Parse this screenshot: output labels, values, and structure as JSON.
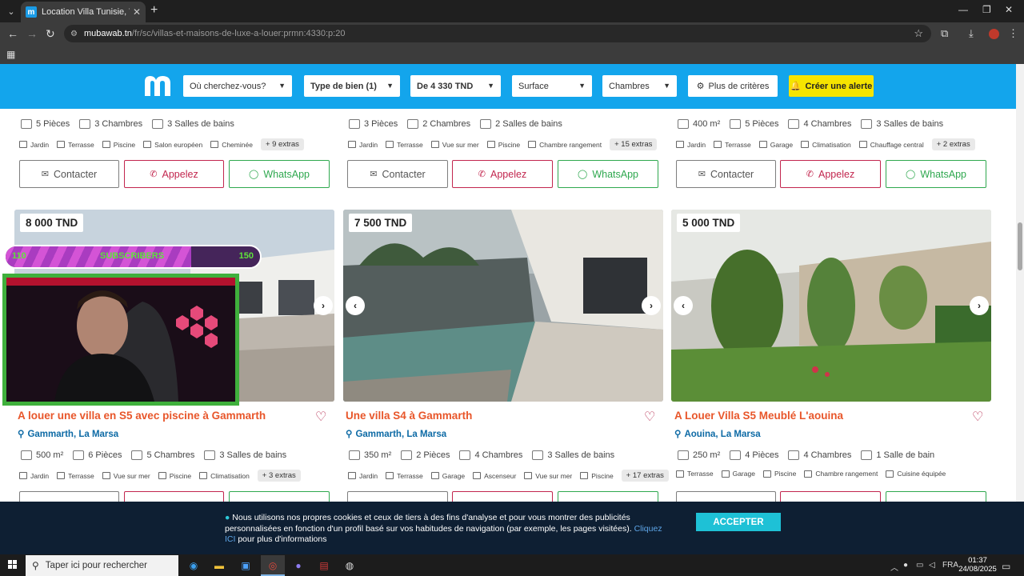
{
  "browser": {
    "tab_title": "Location Villa Tunisie, Villa à Lo",
    "favicon_letter": "m",
    "url_host": "mubawab.tn",
    "url_path": "/fr/sc/villas-et-maisons-de-luxe-a-louer:prmn:4330:p:20"
  },
  "header": {
    "where": "Où cherchez-vous?",
    "type": "Type de bien (1)",
    "price": "De 4 330 TND",
    "surface": "Surface",
    "rooms": "Chambres",
    "more": "Plus de critères",
    "alert": "Créer une alerte"
  },
  "top_row": [
    {
      "stats": [
        "5 Pièces",
        "3 Chambres",
        "3 Salles de bains"
      ],
      "extras": [
        "Jardin",
        "Terrasse",
        "Piscine",
        "Salon européen",
        "Cheminée"
      ],
      "extras_more": "+ 9 extras"
    },
    {
      "stats": [
        "3 Pièces",
        "2 Chambres",
        "2 Salles de bains"
      ],
      "extras": [
        "Jardin",
        "Terrasse",
        "Vue sur mer",
        "Piscine",
        "Chambre rangement"
      ],
      "extras_more": "+ 15 extras"
    },
    {
      "stats": [
        "400 m²",
        "5 Pièces",
        "4 Chambres",
        "3 Salles de bains"
      ],
      "extras": [
        "Jardin",
        "Terrasse",
        "Garage",
        "Climatisation",
        "Chauffage central"
      ],
      "extras_more": "+ 2 extras"
    }
  ],
  "buttons": {
    "contact": "Contacter",
    "call": "Appelez",
    "whatsapp": "WhatsApp"
  },
  "listings": [
    {
      "price": "8 000 TND",
      "title": "A louer une villa en S5 avec piscine à Gammarth",
      "location": "Gammarth, La Marsa",
      "stats": [
        "500 m²",
        "6 Pièces",
        "5 Chambres",
        "3 Salles de bains"
      ],
      "extras": [
        "Jardin",
        "Terrasse",
        "Vue sur mer",
        "Piscine",
        "Climatisation"
      ],
      "extras_more": "+ 3 extras"
    },
    {
      "price": "7 500 TND",
      "title": "Une villa S4 à Gammarth",
      "location": "Gammarth, La Marsa",
      "stats": [
        "350 m²",
        "2 Pièces",
        "4 Chambres",
        "3 Salles de bains"
      ],
      "extras": [
        "Jardin",
        "Terrasse",
        "Garage",
        "Ascenseur",
        "Vue sur mer",
        "Piscine"
      ],
      "extras_more": "+ 17 extras"
    },
    {
      "price": "5 000 TND",
      "title": "A Louer Villa S5 Meublé L'aouina",
      "location": "Aouina, La Marsa",
      "stats": [
        "250 m²",
        "4 Pièces",
        "4 Chambres",
        "1 Salle de bain"
      ],
      "extras": [
        "Terrasse",
        "Garage",
        "Piscine",
        "Chambre rangement",
        "Cuisine équipée"
      ],
      "extras_more": ""
    }
  ],
  "overlay": {
    "sub_current": "110",
    "sub_label": "SUBSCRIBERS",
    "sub_goal": "150",
    "progress": 0.73
  },
  "cookie": {
    "text": "Nous utilisons nos propres cookies et ceux de tiers à des fins d'analyse et pour vous montrer des publicités personnalisées en fonction d'un profil basé sur vos habitudes de navigation (par exemple, les pages visitées).",
    "link": "Cliquez ICI",
    "tail": "pour plus d'informations",
    "accept": "ACCEPTER"
  },
  "taskbar": {
    "search": "Taper ici pour rechercher",
    "lang": "FRA",
    "time": "01:37",
    "date": "24/08/2025"
  },
  "colors": {
    "brand_blue": "#13a5ec",
    "alert_yellow": "#f5e400",
    "title_orange": "#e8562a",
    "call_red": "#c2264e",
    "whatsapp_green": "#2fa84f"
  }
}
